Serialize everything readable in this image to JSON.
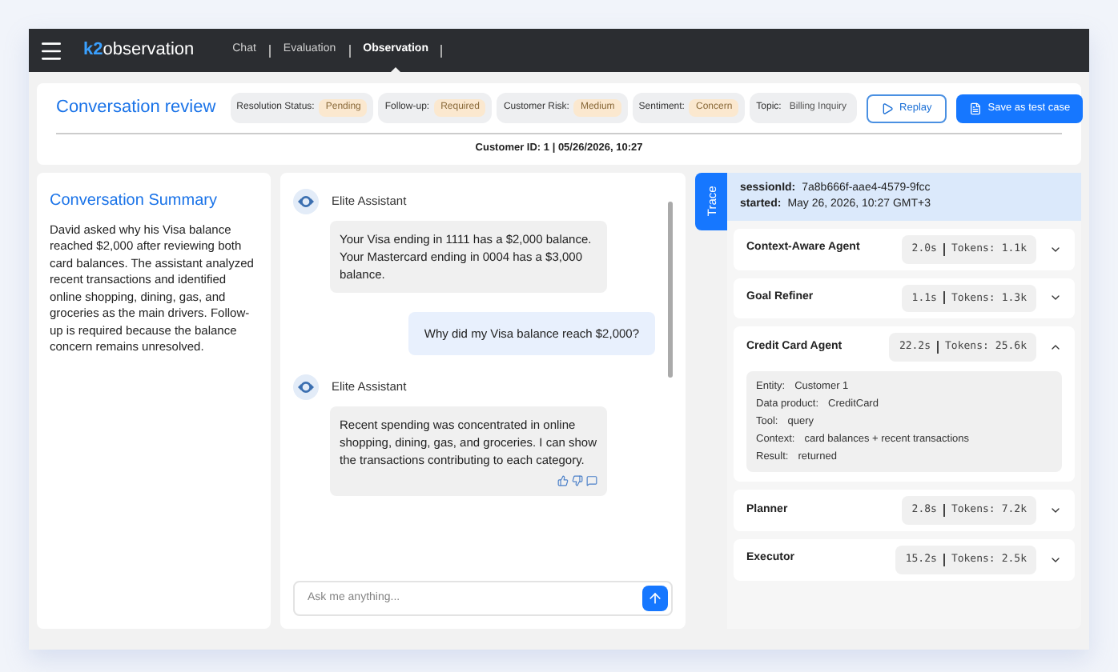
{
  "logo": {
    "mark": "k2",
    "name": "observation"
  },
  "nav": [
    {
      "label": "Chat",
      "selected": false
    },
    {
      "label": "Evaluation",
      "selected": false
    },
    {
      "label": "Observation",
      "selected": true
    }
  ],
  "header": {
    "title": "Conversation review",
    "tags": [
      {
        "label": "Resolution Status:",
        "value": "Pending",
        "highlight": true
      },
      {
        "label": "Follow-up:",
        "value": "Required",
        "highlight": true
      },
      {
        "label": "Customer Risk:",
        "value": "Medium",
        "highlight": true
      },
      {
        "label": "Sentiment:",
        "value": "Concern",
        "highlight": true
      },
      {
        "label": "Topic:",
        "value": "Billing Inquiry",
        "highlight": false
      }
    ],
    "buttons": [
      {
        "label": "Replay",
        "kind": "outline"
      },
      {
        "label": "Save as test case",
        "kind": "primary"
      }
    ],
    "customer_line": "Customer ID: 1 | 05/26/2026, 10:27"
  },
  "summary": {
    "title": "Conversation Summary",
    "text": "David asked why his Visa balance reached $2,000 after reviewing both card balances. The assistant analyzed recent transactions and identified online shopping, dining, gas, and groceries as the main drivers. Follow-up is required because the balance concern remains unresolved."
  },
  "chat": {
    "messages": [
      {
        "kind": "assistant",
        "sender": "Elite Assistant",
        "text": "Your Visa ending in 1111 has a $2,000 balance. Your Mastercard ending in 0004 has a $3,000 balance.",
        "feedback": false
      },
      {
        "kind": "user",
        "text": "Why did my Visa balance reach $2,000?"
      },
      {
        "kind": "assistant",
        "sender": "Elite Assistant",
        "text": "Recent spending was concentrated in online shopping, dining, gas, and groceries. I can show the transactions contributing to each category.",
        "feedback": true
      }
    ],
    "input": {
      "placeholder": "Ask me anything..."
    }
  },
  "trace": {
    "tab": "Trace",
    "session_label": "sessionId:",
    "session_id": "7a8b666f-aae4-4579-9fcc",
    "started_label": "started:",
    "started": "May 26, 2026, 10:27 GMT+3",
    "agents": [
      {
        "name": "Context-Aware Agent",
        "time": "2.0s",
        "tokens_label": "Tokens:",
        "tokens": "1.1k",
        "expanded": false
      },
      {
        "name": "Goal Refiner",
        "time": "1.1s",
        "tokens_label": "Tokens:",
        "tokens": "1.3k",
        "expanded": false
      },
      {
        "name": "Credit Card Agent",
        "time": "22.2s",
        "tokens_label": "Tokens:",
        "tokens": "25.6k",
        "expanded": true,
        "details": [
          {
            "label": "Entity:",
            "value": "Customer 1"
          },
          {
            "label": "Data product:",
            "value": "CreditCard"
          },
          {
            "label": "Tool:",
            "value": "query"
          },
          {
            "label": "Context:",
            "value": "card balances + recent transactions"
          },
          {
            "label": "Result:",
            "value": "returned"
          }
        ]
      },
      {
        "name": "Planner",
        "time": "2.8s",
        "tokens_label": "Tokens:",
        "tokens": "7.2k",
        "expanded": false
      },
      {
        "name": "Executor",
        "time": "15.2s",
        "tokens_label": "Tokens:",
        "tokens": "2.5k",
        "expanded": false
      }
    ]
  }
}
